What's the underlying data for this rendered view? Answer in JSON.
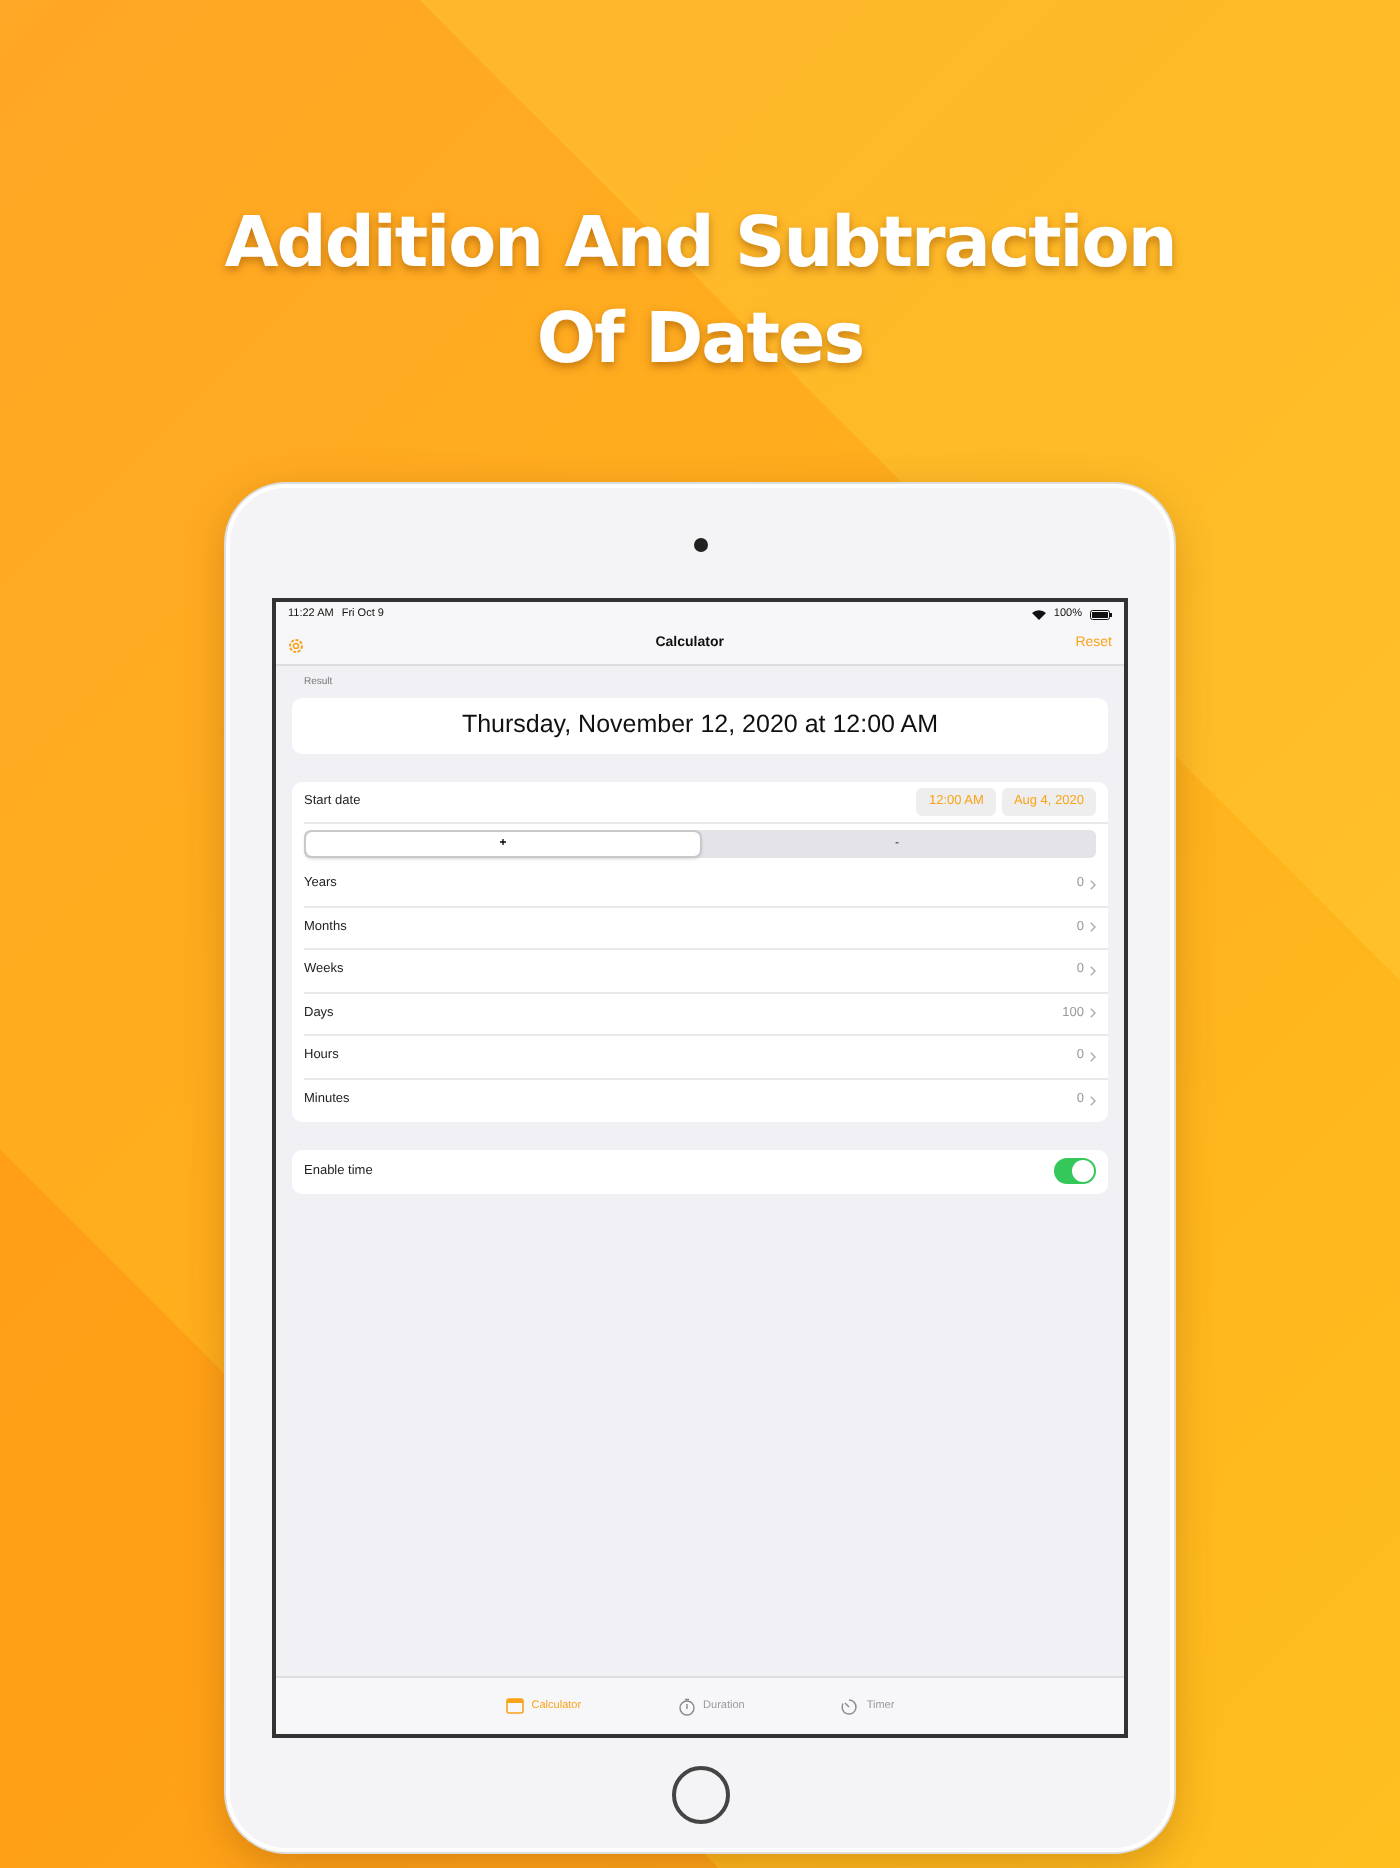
{
  "headline": [
    "Addition And Subtraction",
    "Of Dates"
  ],
  "status_bar": {
    "time": "11:22 AM",
    "date": "Fri Oct 9",
    "battery": "100%"
  },
  "nav_bar": {
    "title": "Calculator",
    "action": "Reset"
  },
  "result": {
    "header": "Result",
    "value": "Thursday, November 12, 2020 at 12:00 AM"
  },
  "start_date": {
    "label": "Start date",
    "time": "12:00 AM",
    "date": "Aug 4, 2020"
  },
  "segments": [
    {
      "label": "+",
      "selected": true
    },
    {
      "label": "-",
      "selected": false
    }
  ],
  "rows": [
    {
      "label": "Years",
      "value": "0"
    },
    {
      "label": "Months",
      "value": "0"
    },
    {
      "label": "Weeks",
      "value": "0"
    },
    {
      "label": "Days",
      "value": "100"
    },
    {
      "label": "Hours",
      "value": "0"
    },
    {
      "label": "Minutes",
      "value": "0"
    }
  ],
  "toggle": {
    "label": "Enable time",
    "on": true
  },
  "tabs": [
    {
      "label": "Calculator",
      "kind": "calendar",
      "selected": true
    },
    {
      "label": "Duration",
      "kind": "stopwatch",
      "selected": false
    },
    {
      "label": "Timer",
      "kind": "timer",
      "selected": false
    }
  ]
}
